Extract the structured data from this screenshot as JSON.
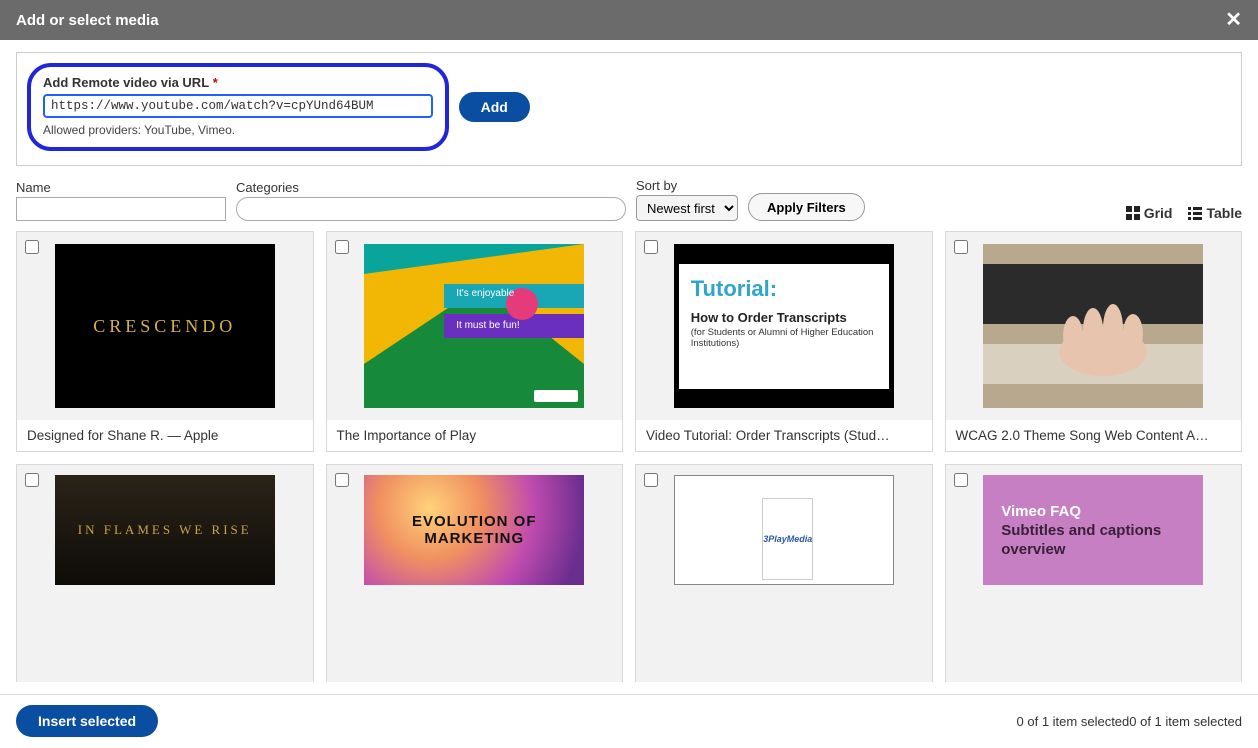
{
  "dialog": {
    "title": "Add or select media"
  },
  "remote": {
    "label": "Add Remote video via URL",
    "value": "https://www.youtube.com/watch?v=cpYUnd64BUM",
    "hint": "Allowed providers: YouTube, Vimeo.",
    "add_label": "Add"
  },
  "filters": {
    "name_label": "Name",
    "name_value": "",
    "categories_label": "Categories",
    "categories_value": "",
    "sort_label": "Sort by",
    "sort_value": "Newest first",
    "apply_label": "Apply Filters"
  },
  "view": {
    "grid_label": "Grid",
    "table_label": "Table"
  },
  "items": [
    {
      "title": "Designed for Shane R. — Apple",
      "thumb_text": "CRESCENDO"
    },
    {
      "title": "The Importance of Play",
      "line1": "It's enjoyable",
      "line2": "It must be fun!"
    },
    {
      "title": "Video Tutorial: Order Transcripts (Stud…",
      "tword": "Tutorial:",
      "sub1": "How to Order Transcripts",
      "sub2": "(for Students or Alumni of Higher Education Institutions)"
    },
    {
      "title": "WCAG 2.0 Theme Song Web Content A…"
    },
    {
      "title": "",
      "thumb_text": "IN FLAMES WE RISE"
    },
    {
      "title": "",
      "thumb_text": "EVOLUTION OF MARKETING"
    },
    {
      "title": "",
      "brand": "3PlayMedia"
    },
    {
      "title": "",
      "h": "Vimeo FAQ",
      "s": "Subtitles and captions overview"
    }
  ],
  "footer": {
    "insert_label": "Insert selected",
    "status": "0 of 1 item selected0 of 1 item selected"
  }
}
